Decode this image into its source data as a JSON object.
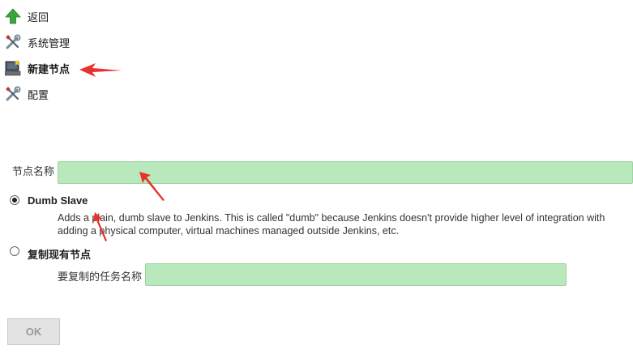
{
  "sidebar": {
    "items": [
      {
        "label": "返回",
        "icon": "up-arrow-icon"
      },
      {
        "label": "系统管理",
        "icon": "wrench-screwdriver-icon"
      },
      {
        "label": "新建节点",
        "icon": "computer-icon"
      },
      {
        "label": "配置",
        "icon": "wrench-screwdriver-icon"
      }
    ]
  },
  "form": {
    "node_name_label": "节点名称",
    "node_name_value": "",
    "options": [
      {
        "label": "Dumb Slave",
        "selected": true,
        "description_line1": "Adds a plain, dumb slave to Jenkins. This is called \"dumb\" because Jenkins doesn't provide higher level of integration with",
        "description_line2": "adding a physical computer, virtual machines managed outside Jenkins, etc."
      },
      {
        "label": "复制现有节点",
        "selected": false,
        "copy_from_label": "要复制的任务名称",
        "copy_from_value": ""
      }
    ],
    "ok_label": "OK"
  },
  "colors": {
    "field_bg": "#b8e8bb",
    "annotation_arrow": "#e8322d",
    "up_arrow": "#3aa53a"
  }
}
